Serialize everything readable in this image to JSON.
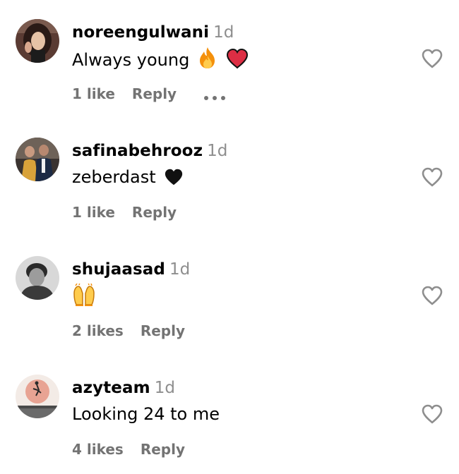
{
  "comments": [
    {
      "username": "noreengulwani",
      "time": "1d",
      "text": "Always young",
      "emojis": [
        "fire-emoji",
        "red-heart-emoji"
      ],
      "likes": "1 like",
      "reply": "Reply",
      "has_more_menu": true
    },
    {
      "username": "safinabehrooz",
      "time": "1d",
      "text": "zeberdast",
      "emojis": [
        "black-heart-emoji"
      ],
      "likes": "1 like",
      "reply": "Reply"
    },
    {
      "username": "shujaasad",
      "time": "1d",
      "text": "",
      "emojis": [
        "raising-hands-emoji"
      ],
      "likes": "2 likes",
      "reply": "Reply"
    },
    {
      "username": "azyteam",
      "time": "1d",
      "text": "Looking 24 to me",
      "emojis": [],
      "likes": "4 likes",
      "reply": "Reply"
    }
  ],
  "icons": {
    "like": "heart-outline-icon",
    "more": "more-options-icon"
  },
  "colors": {
    "text": "#000000",
    "secondary": "#8e8e8e",
    "meta": "#737373",
    "icon": "#8e8e8e"
  }
}
